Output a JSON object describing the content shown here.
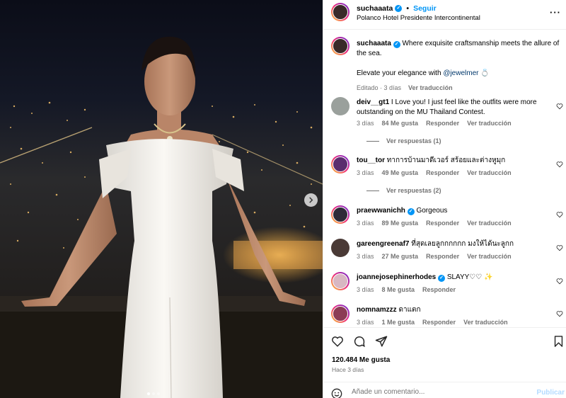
{
  "post": {
    "username": "suchaaata",
    "follow_label": "Seguir",
    "separator": "•",
    "location": "Polanco Hotel Presidente Intercontinental",
    "more_label": "···"
  },
  "caption": {
    "username": "suchaaata",
    "text_1": "Where exquisite craftsmanship meets the allure of the sea.",
    "text_2_prefix": "Elevate your elegance with",
    "mention": "@jewelmer",
    "ring_emoji": "💍",
    "edited": "Editado · 3 días",
    "translate": "Ver traducción"
  },
  "comments": [
    {
      "username": "deiv__gt1",
      "verified": false,
      "text": "I Love you! I just feel like the outfits were more outstanding on the MU Thailand Contest.",
      "time": "3 días",
      "likes": "84 Me gusta",
      "reply": "Responder",
      "translate": "Ver traducción",
      "replies": "Ver respuestas (1)",
      "avatar_color": "#9aa09c"
    },
    {
      "username": "tou__tor",
      "verified": false,
      "text": "ทาการบ้านมาดีเวอร์ สร้อยและต่างหูมุก",
      "time": "3 días",
      "likes": "49 Me gusta",
      "reply": "Responder",
      "translate": "Ver traducción",
      "replies": "Ver respuestas (2)",
      "avatar_color": "#5b2d6e"
    },
    {
      "username": "praewwanichh",
      "verified": true,
      "text": "Gorgeous",
      "time": "3 días",
      "likes": "89 Me gusta",
      "reply": "Responder",
      "translate": "Ver traducción",
      "replies": "",
      "avatar_color": "#2f2a38"
    },
    {
      "username": "gareengreenaf7",
      "verified": false,
      "text": "ที่สุดเลยลูกกกกกก มงให้ได้นะลูกก",
      "time": "3 días",
      "likes": "27 Me gusta",
      "reply": "Responder",
      "translate": "Ver traducción",
      "replies": "",
      "avatar_color": "#4a3a36"
    },
    {
      "username": "joannejosephinerhodes",
      "verified": true,
      "text": "SLAYY♡♡ ✨",
      "time": "3 días",
      "likes": "8 Me gusta",
      "reply": "Responder",
      "translate": "",
      "replies": "",
      "avatar_color": "#d8b7c2"
    },
    {
      "username": "nomnamzzz",
      "verified": false,
      "text": "ดาแตก",
      "time": "3 días",
      "likes": "1 Me gusta",
      "reply": "Responder",
      "translate": "Ver traducción",
      "replies": "",
      "avatar_color": "#8c3c55"
    }
  ],
  "actions": {
    "likes": "120.484 Me gusta",
    "date": "Hace 3 días",
    "comment_placeholder": "Añade un comentario...",
    "publish_label": "Publicar"
  },
  "icons": [
    "heart-icon",
    "comment-icon",
    "share-icon",
    "bookmark-icon",
    "emoji-icon",
    "chevron-right-icon",
    "more-icon",
    "verified-icon"
  ],
  "colors": {
    "accent": "#0095f6",
    "muted": "#737373",
    "link": "#00376b",
    "publish_disabled": "#b3dbff"
  }
}
